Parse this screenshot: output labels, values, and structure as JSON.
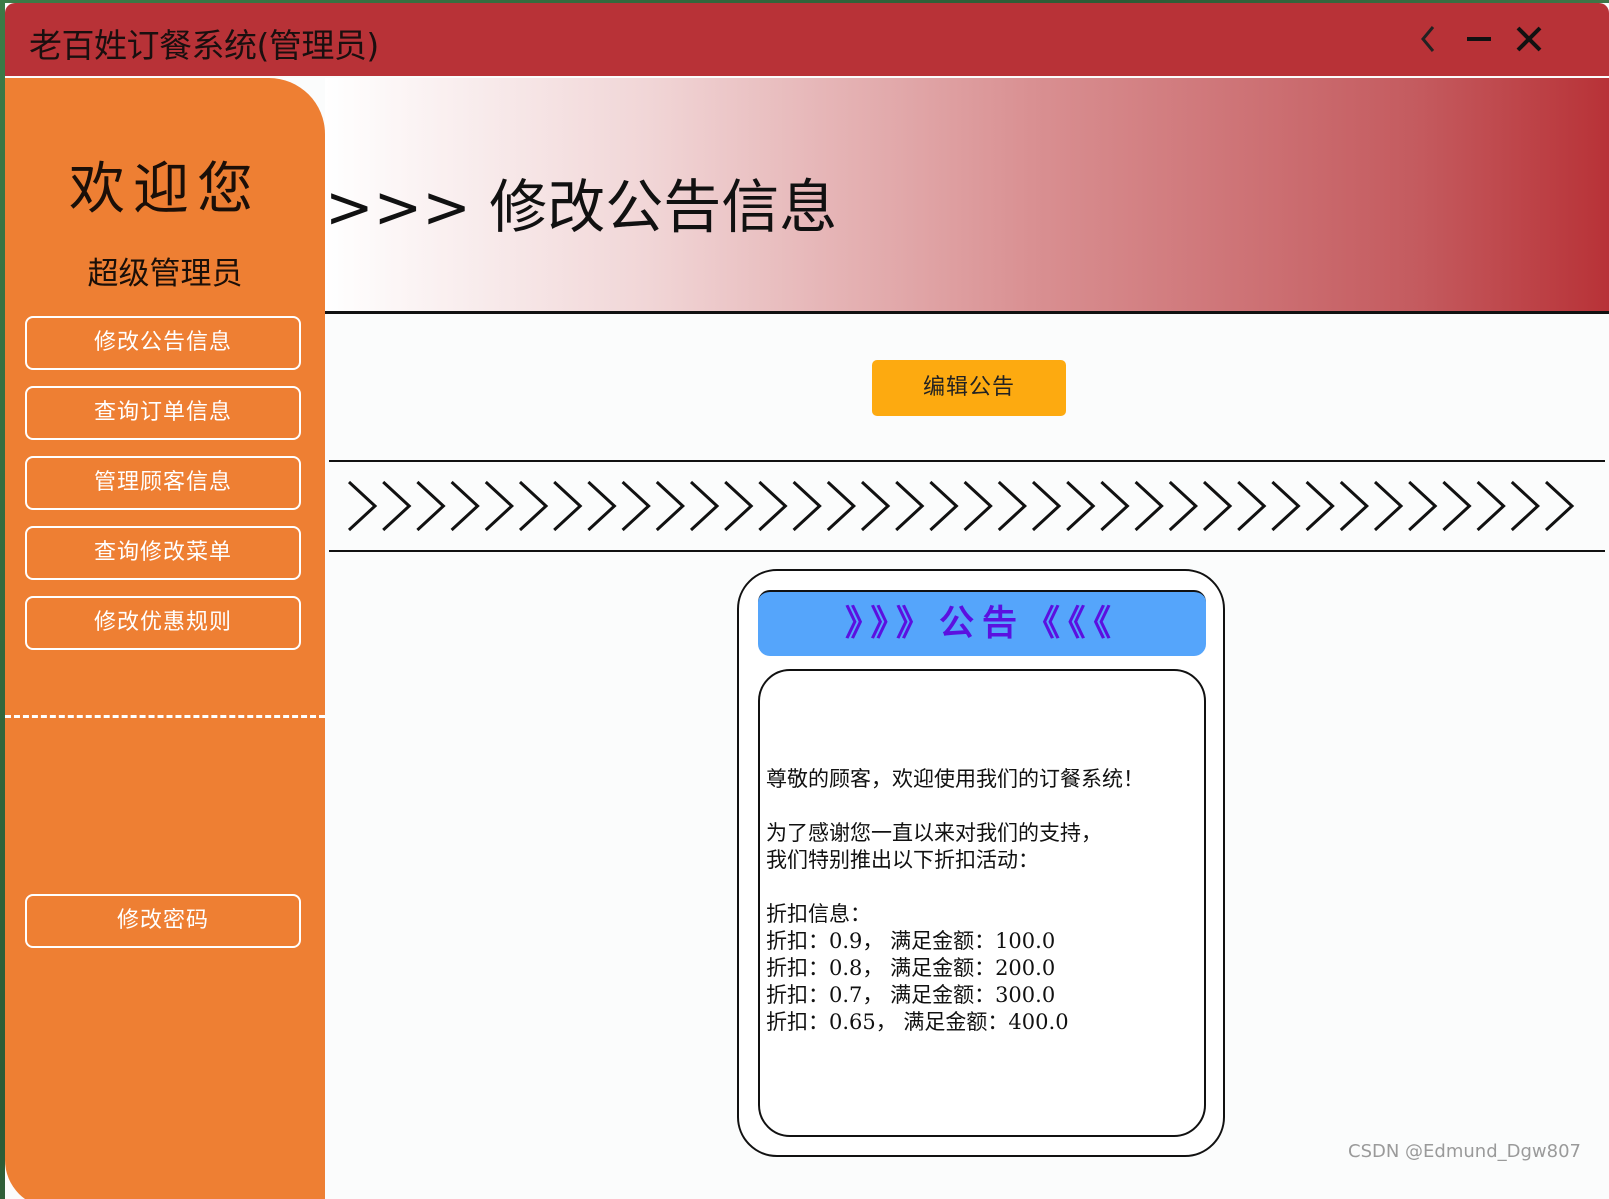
{
  "window": {
    "title": "老百姓订餐系统(管理员)"
  },
  "sidebar": {
    "welcome": "欢迎您",
    "role": "超级管理员",
    "items": [
      {
        "label": "修改公告信息"
      },
      {
        "label": "查询订单信息"
      },
      {
        "label": "管理顾客信息"
      },
      {
        "label": "查询修改菜单"
      },
      {
        "label": "修改优惠规则"
      }
    ],
    "password_button": "修改密码"
  },
  "main": {
    "page_title": ">>> 修改公告信息",
    "edit_button": "编辑公告",
    "notice_title": "》》》公告《《《",
    "notice_text": "尊敬的顾客，欢迎使用我们的订餐系统！\n\n为了感谢您一直以来对我们的支持，\n我们特别推出以下折扣活动：\n\n折扣信息：\n折扣：0.9， 满足金额：100.0\n折扣：0.8， 满足金额：200.0\n折扣：0.7， 满足金额：300.0\n折扣：0.65， 满足金额：400.0"
  },
  "watermark": "CSDN @Edmund_Dgw807",
  "colors": {
    "titlebar": "#b83237",
    "sidebar": "#ee7f33",
    "edit_button": "#fdaa10",
    "notice_header": "#55a5fb",
    "notice_title_text": "#5b10e0"
  },
  "icons": [
    "back-chevron-icon",
    "minimize-icon",
    "close-icon",
    "chevron-right-icon"
  ]
}
